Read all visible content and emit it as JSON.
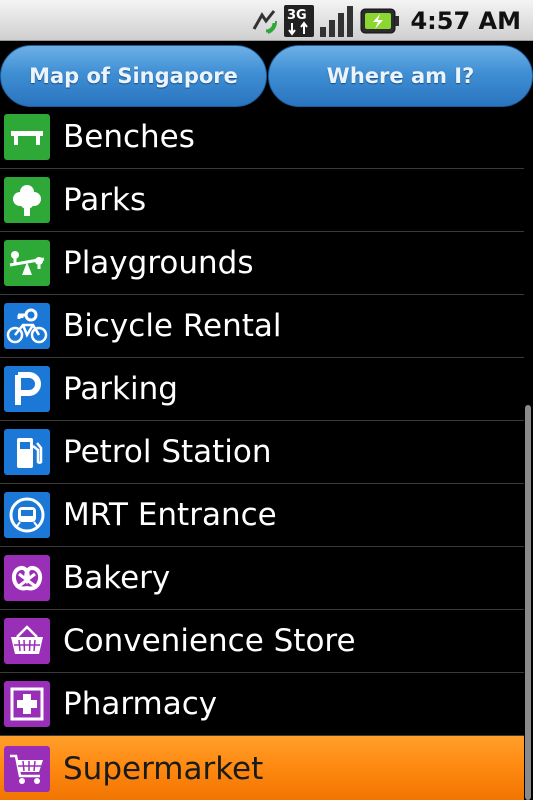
{
  "status_bar": {
    "time": "4:57 AM",
    "icons": [
      "sync-icon",
      "3g-data-icon",
      "signal-icon",
      "battery-charging-icon"
    ],
    "network": "3G"
  },
  "header": {
    "map_button": "Map of Singapore",
    "where_button": "Where am I?"
  },
  "list": {
    "items": [
      {
        "label": "Benches",
        "icon": "bench-icon",
        "color": "#2ea836"
      },
      {
        "label": "Parks",
        "icon": "tree-icon",
        "color": "#2ea836"
      },
      {
        "label": "Playgrounds",
        "icon": "seesaw-icon",
        "color": "#2ea836"
      },
      {
        "label": "Bicycle Rental",
        "icon": "bicycle-key-icon",
        "color": "#1b78d6"
      },
      {
        "label": "Parking",
        "icon": "parking-p-icon",
        "color": "#1b78d6"
      },
      {
        "label": "Petrol Station",
        "icon": "fuel-pump-icon",
        "color": "#1b78d6"
      },
      {
        "label": "MRT Entrance",
        "icon": "train-icon",
        "color": "#1b78d6"
      },
      {
        "label": "Bakery",
        "icon": "pretzel-icon",
        "color": "#9a2fb7"
      },
      {
        "label": "Convenience Store",
        "icon": "basket-icon",
        "color": "#9a2fb7"
      },
      {
        "label": "Pharmacy",
        "icon": "medical-cross-icon",
        "color": "#9a2fb7"
      },
      {
        "label": "Supermarket",
        "icon": "shopping-cart-icon",
        "color": "#9a2fb7",
        "selected": true
      }
    ]
  },
  "colors": {
    "selected_highlight": "#ff8a12",
    "button_blue": "#3f8fd4"
  }
}
